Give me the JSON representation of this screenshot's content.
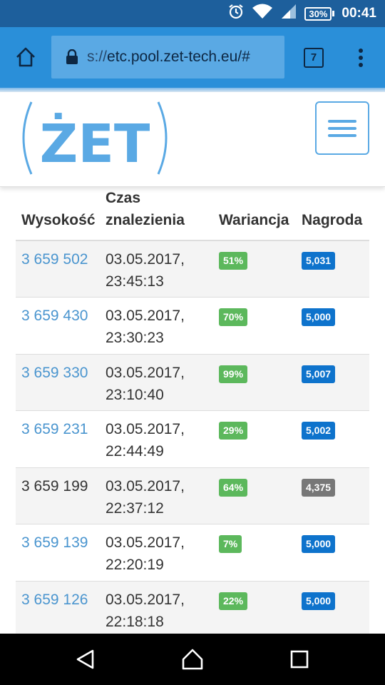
{
  "status_bar": {
    "battery": "30%",
    "time": "00:41",
    "icons": [
      "alarm-icon",
      "wifi-icon",
      "signal-icon",
      "battery-icon"
    ]
  },
  "browser": {
    "url_scheme": "s://",
    "url_host": "etc.pool.zet-tech.eu/#",
    "tab_count": "7",
    "colors": {
      "toolbar": "#2a8fd9",
      "status": "#1d5f9c",
      "urlbox": "#5aa9e4"
    }
  },
  "site": {
    "logo_text": "ŻET",
    "colors": {
      "accent": "#5aa9e4",
      "link": "#4a95cf"
    }
  },
  "table": {
    "headers": {
      "height": "Wysokość",
      "time_line1": "Czas",
      "time_line2": "znalezienia",
      "variance": "Wariancja",
      "reward": "Nagroda"
    },
    "rows": [
      {
        "height": "3 659 502",
        "date": "03.05.2017,",
        "time": "23:45:13",
        "variance": "51%",
        "reward": "5,031"
      },
      {
        "height": "3 659 430",
        "date": "03.05.2017,",
        "time": "23:30:23",
        "variance": "70%",
        "reward": "5,000"
      },
      {
        "height": "3 659 330",
        "date": "03.05.2017,",
        "time": "23:10:40",
        "variance": "99%",
        "reward": "5,007"
      },
      {
        "height": "3 659 231",
        "date": "03.05.2017,",
        "time": "22:44:49",
        "variance": "29%",
        "reward": "5,002"
      },
      {
        "height": "3 659 199",
        "date": "03.05.2017,",
        "time": "22:37:12",
        "variance": "64%",
        "reward": "4,375"
      },
      {
        "height": "3 659 139",
        "date": "03.05.2017,",
        "time": "22:20:19",
        "variance": "7%",
        "reward": "5,000"
      },
      {
        "height": "3 659 126",
        "date": "03.05.2017,",
        "time": "22:18:18",
        "variance": "22%",
        "reward": "5,000"
      }
    ]
  },
  "nav_bar": {
    "icons": [
      "back-icon",
      "home-icon",
      "recents-icon"
    ]
  }
}
